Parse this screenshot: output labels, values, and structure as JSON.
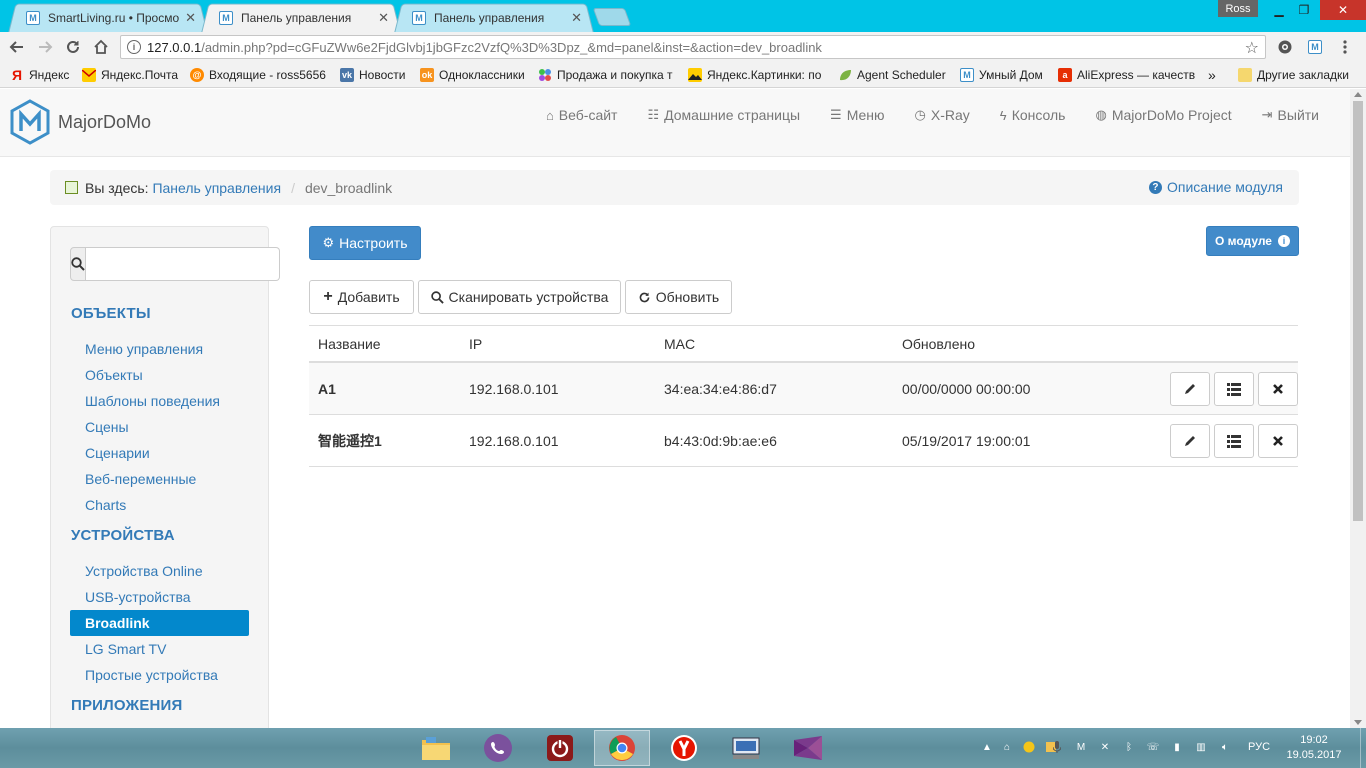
{
  "browser": {
    "tabs": [
      {
        "title": "SmartLiving.ru • Просмо",
        "active": false
      },
      {
        "title": "Панель управления",
        "active": true
      },
      {
        "title": "Панель управления",
        "active": false
      }
    ],
    "user": "Ross",
    "url_host": "127.0.0.1",
    "url_path": "/admin.php?pd=cGFuZWw6e2FjdGlvbj1jbGFzc2VzfQ%3D%3Dpz_&md=panel&inst=&action=dev_broadlink",
    "bookmarks": [
      {
        "label": "Яндекс",
        "icon": "yandex-icon"
      },
      {
        "label": "Яндекс.Почта",
        "icon": "mail-icon"
      },
      {
        "label": "Входящие - ross5656",
        "icon": "at-icon"
      },
      {
        "label": "Новости",
        "icon": "vk-icon"
      },
      {
        "label": "Одноклассники",
        "icon": "ok-icon"
      },
      {
        "label": "Продажа и покупка т",
        "icon": "dots-icon"
      },
      {
        "label": "Яндекс.Картинки: по",
        "icon": "images-icon"
      },
      {
        "label": "Agent Scheduler",
        "icon": "leaf-icon"
      },
      {
        "label": "Умный Дом",
        "icon": "majordomo-icon"
      },
      {
        "label": "AliExpress — качеств",
        "icon": "aliexpress-icon"
      }
    ],
    "more_bookmarks": "»",
    "other_bookmarks": "Другие закладки"
  },
  "header": {
    "brand": "MajorDoMo",
    "menu": [
      {
        "label": "Веб-сайт",
        "icon": "home-icon"
      },
      {
        "label": "Домашние страницы",
        "icon": "list-icon"
      },
      {
        "label": "Меню",
        "icon": "menu-icon"
      },
      {
        "label": "X-Ray",
        "icon": "dashboard-icon"
      },
      {
        "label": "Консоль",
        "icon": "bolt-icon"
      },
      {
        "label": "MajorDoMo Project",
        "icon": "globe-icon"
      },
      {
        "label": "Выйти",
        "icon": "logout-icon"
      }
    ]
  },
  "breadcrumb": {
    "prefix": "Вы здесь:",
    "link": "Панель управления",
    "separator": "/",
    "current": "dev_broadlink",
    "help": "Описание модуля"
  },
  "sidebar": {
    "search_placeholder": "",
    "sections": [
      {
        "title": "ОБЪЕКТЫ",
        "items": [
          "Меню управления",
          "Объекты",
          "Шаблоны поведения",
          "Сцены",
          "Сценарии",
          "Веб-переменные",
          "Charts"
        ]
      },
      {
        "title": "УСТРОЙСТВА",
        "items": [
          "Устройства Online",
          "USB-устройства",
          "Broadlink",
          "LG Smart TV",
          "Простые устройства"
        ]
      },
      {
        "title": "ПРИЛОЖЕНИЯ",
        "items": []
      }
    ],
    "active_item": "Broadlink"
  },
  "main": {
    "configure_button": "Настроить",
    "about_button": "О модуле",
    "add_button": "Добавить",
    "scan_button": "Сканировать устройства",
    "refresh_button": "Обновить",
    "table": {
      "columns": [
        "Название",
        "IP",
        "MAC",
        "Обновлено"
      ],
      "rows": [
        {
          "name": "A1",
          "ip": "192.168.0.101",
          "mac": "34:ea:34:e4:86:d7",
          "updated": "00/00/0000 00:00:00"
        },
        {
          "name": "智能遥控1",
          "ip": "192.168.0.101",
          "mac": "b4:43:0d:9b:ae:e6",
          "updated": "05/19/2017 19:00:01"
        }
      ]
    }
  },
  "taskbar": {
    "apps": [
      "explorer-icon",
      "viber-icon",
      "power-icon",
      "chrome-icon",
      "yandex-browser-icon",
      "keyboard-icon",
      "visual-studio-icon"
    ],
    "language": "РУС",
    "time": "19:02",
    "date": "19.05.2017"
  },
  "colors": {
    "primary": "#428bca",
    "link": "#337ab7",
    "active_nav": "#0388cc",
    "tabstrip": "#00c4e6"
  }
}
